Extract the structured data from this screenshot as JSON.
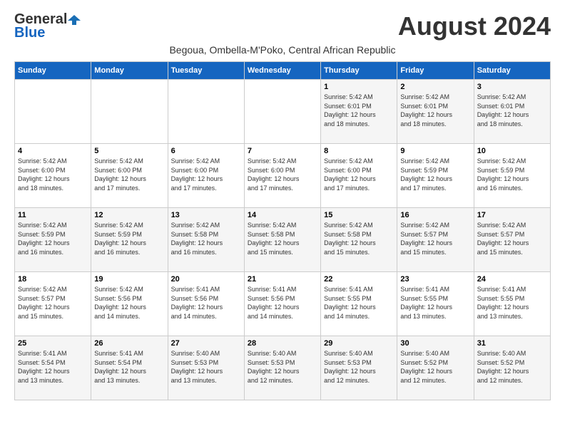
{
  "logo": {
    "general": "General",
    "blue": "Blue"
  },
  "title": "August 2024",
  "subtitle": "Begoua, Ombella-M'Poko, Central African Republic",
  "days_of_week": [
    "Sunday",
    "Monday",
    "Tuesday",
    "Wednesday",
    "Thursday",
    "Friday",
    "Saturday"
  ],
  "weeks": [
    [
      {
        "day": "",
        "info": ""
      },
      {
        "day": "",
        "info": ""
      },
      {
        "day": "",
        "info": ""
      },
      {
        "day": "",
        "info": ""
      },
      {
        "day": "1",
        "info": "Sunrise: 5:42 AM\nSunset: 6:01 PM\nDaylight: 12 hours\nand 18 minutes."
      },
      {
        "day": "2",
        "info": "Sunrise: 5:42 AM\nSunset: 6:01 PM\nDaylight: 12 hours\nand 18 minutes."
      },
      {
        "day": "3",
        "info": "Sunrise: 5:42 AM\nSunset: 6:01 PM\nDaylight: 12 hours\nand 18 minutes."
      }
    ],
    [
      {
        "day": "4",
        "info": "Sunrise: 5:42 AM\nSunset: 6:00 PM\nDaylight: 12 hours\nand 18 minutes."
      },
      {
        "day": "5",
        "info": "Sunrise: 5:42 AM\nSunset: 6:00 PM\nDaylight: 12 hours\nand 17 minutes."
      },
      {
        "day": "6",
        "info": "Sunrise: 5:42 AM\nSunset: 6:00 PM\nDaylight: 12 hours\nand 17 minutes."
      },
      {
        "day": "7",
        "info": "Sunrise: 5:42 AM\nSunset: 6:00 PM\nDaylight: 12 hours\nand 17 minutes."
      },
      {
        "day": "8",
        "info": "Sunrise: 5:42 AM\nSunset: 6:00 PM\nDaylight: 12 hours\nand 17 minutes."
      },
      {
        "day": "9",
        "info": "Sunrise: 5:42 AM\nSunset: 5:59 PM\nDaylight: 12 hours\nand 17 minutes."
      },
      {
        "day": "10",
        "info": "Sunrise: 5:42 AM\nSunset: 5:59 PM\nDaylight: 12 hours\nand 16 minutes."
      }
    ],
    [
      {
        "day": "11",
        "info": "Sunrise: 5:42 AM\nSunset: 5:59 PM\nDaylight: 12 hours\nand 16 minutes."
      },
      {
        "day": "12",
        "info": "Sunrise: 5:42 AM\nSunset: 5:59 PM\nDaylight: 12 hours\nand 16 minutes."
      },
      {
        "day": "13",
        "info": "Sunrise: 5:42 AM\nSunset: 5:58 PM\nDaylight: 12 hours\nand 16 minutes."
      },
      {
        "day": "14",
        "info": "Sunrise: 5:42 AM\nSunset: 5:58 PM\nDaylight: 12 hours\nand 15 minutes."
      },
      {
        "day": "15",
        "info": "Sunrise: 5:42 AM\nSunset: 5:58 PM\nDaylight: 12 hours\nand 15 minutes."
      },
      {
        "day": "16",
        "info": "Sunrise: 5:42 AM\nSunset: 5:57 PM\nDaylight: 12 hours\nand 15 minutes."
      },
      {
        "day": "17",
        "info": "Sunrise: 5:42 AM\nSunset: 5:57 PM\nDaylight: 12 hours\nand 15 minutes."
      }
    ],
    [
      {
        "day": "18",
        "info": "Sunrise: 5:42 AM\nSunset: 5:57 PM\nDaylight: 12 hours\nand 15 minutes."
      },
      {
        "day": "19",
        "info": "Sunrise: 5:42 AM\nSunset: 5:56 PM\nDaylight: 12 hours\nand 14 minutes."
      },
      {
        "day": "20",
        "info": "Sunrise: 5:41 AM\nSunset: 5:56 PM\nDaylight: 12 hours\nand 14 minutes."
      },
      {
        "day": "21",
        "info": "Sunrise: 5:41 AM\nSunset: 5:56 PM\nDaylight: 12 hours\nand 14 minutes."
      },
      {
        "day": "22",
        "info": "Sunrise: 5:41 AM\nSunset: 5:55 PM\nDaylight: 12 hours\nand 14 minutes."
      },
      {
        "day": "23",
        "info": "Sunrise: 5:41 AM\nSunset: 5:55 PM\nDaylight: 12 hours\nand 13 minutes."
      },
      {
        "day": "24",
        "info": "Sunrise: 5:41 AM\nSunset: 5:55 PM\nDaylight: 12 hours\nand 13 minutes."
      }
    ],
    [
      {
        "day": "25",
        "info": "Sunrise: 5:41 AM\nSunset: 5:54 PM\nDaylight: 12 hours\nand 13 minutes."
      },
      {
        "day": "26",
        "info": "Sunrise: 5:41 AM\nSunset: 5:54 PM\nDaylight: 12 hours\nand 13 minutes."
      },
      {
        "day": "27",
        "info": "Sunrise: 5:40 AM\nSunset: 5:53 PM\nDaylight: 12 hours\nand 13 minutes."
      },
      {
        "day": "28",
        "info": "Sunrise: 5:40 AM\nSunset: 5:53 PM\nDaylight: 12 hours\nand 12 minutes."
      },
      {
        "day": "29",
        "info": "Sunrise: 5:40 AM\nSunset: 5:53 PM\nDaylight: 12 hours\nand 12 minutes."
      },
      {
        "day": "30",
        "info": "Sunrise: 5:40 AM\nSunset: 5:52 PM\nDaylight: 12 hours\nand 12 minutes."
      },
      {
        "day": "31",
        "info": "Sunrise: 5:40 AM\nSunset: 5:52 PM\nDaylight: 12 hours\nand 12 minutes."
      }
    ]
  ]
}
